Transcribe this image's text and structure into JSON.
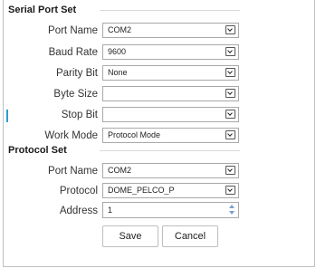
{
  "serial": {
    "title": "Serial Port Set",
    "port_name": {
      "label": "Port Name",
      "value": "COM2"
    },
    "baud_rate": {
      "label": "Baud Rate",
      "value": "9600"
    },
    "parity_bit": {
      "label": "Parity Bit",
      "value": "None"
    },
    "byte_size": {
      "label": "Byte Size",
      "value": ""
    },
    "stop_bit": {
      "label": "Stop Bit",
      "value": ""
    },
    "work_mode": {
      "label": "Work Mode",
      "value": "Protocol Mode"
    }
  },
  "protocol": {
    "title": "Protocol Set",
    "port_name": {
      "label": "Port Name",
      "value": "COM2"
    },
    "protocol": {
      "label": "Protocol",
      "value": "DOME_PELCO_P"
    },
    "address": {
      "label": "Address",
      "value": "1"
    }
  },
  "actions": {
    "save": "Save",
    "cancel": "Cancel"
  },
  "icons": {
    "select": "chevron-down-icon",
    "spinner": "spinner-arrows-icon"
  },
  "colors": {
    "accent": "#2d9bd8",
    "spinner": "#7aa0d0",
    "border": "#a9a9a9"
  }
}
